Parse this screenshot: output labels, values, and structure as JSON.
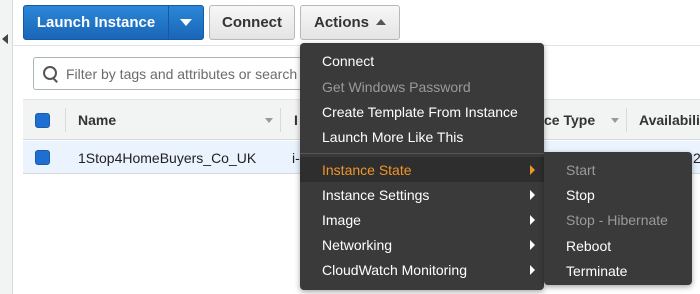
{
  "toolbar": {
    "launch_label": "Launch Instance",
    "connect_label": "Connect",
    "actions_label": "Actions"
  },
  "search": {
    "placeholder": "Filter by tags and attributes or search by keyword"
  },
  "table": {
    "columns": [
      "Name",
      "I",
      "ce Type",
      "Availabili"
    ],
    "rows": [
      {
        "name": "1Stop4HomeBuyers_Co_UK",
        "instance_id": "i-",
        "az": "2"
      }
    ]
  },
  "actions_menu": {
    "items": [
      {
        "label": "Connect",
        "disabled": false
      },
      {
        "label": "Get Windows Password",
        "disabled": true
      },
      {
        "label": "Create Template From Instance",
        "disabled": false
      },
      {
        "label": "Launch More Like This",
        "disabled": false
      },
      {
        "label": "Instance State",
        "active": true,
        "submenu": true
      },
      {
        "label": "Instance Settings",
        "submenu": true
      },
      {
        "label": "Image",
        "submenu": true
      },
      {
        "label": "Networking",
        "submenu": true
      },
      {
        "label": "CloudWatch Monitoring",
        "submenu": true
      }
    ]
  },
  "instance_state_menu": {
    "items": [
      {
        "label": "Start",
        "disabled": true
      },
      {
        "label": "Stop",
        "disabled": false
      },
      {
        "label": "Stop - Hibernate",
        "disabled": true
      },
      {
        "label": "Reboot",
        "disabled": false
      },
      {
        "label": "Terminate",
        "disabled": false
      }
    ]
  },
  "colors": {
    "primary_button": "#1f6fd1",
    "menu_background": "#3a3a3a",
    "menu_active_text": "#f0952b",
    "selected_row": "#eaf3fe"
  }
}
